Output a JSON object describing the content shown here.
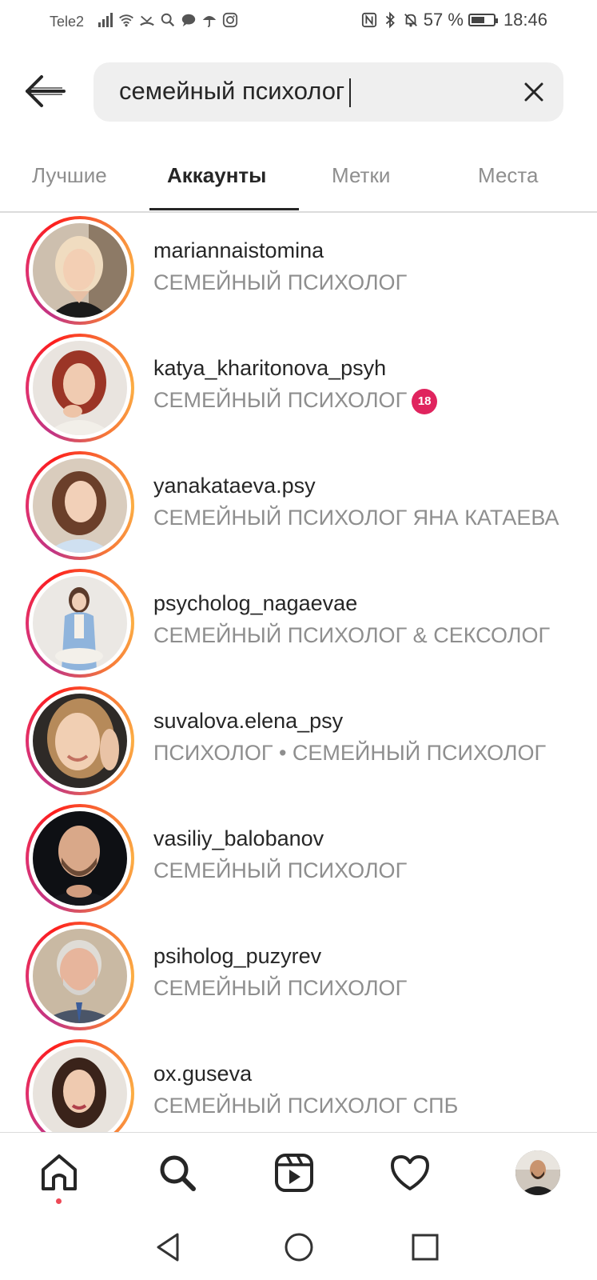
{
  "status_bar": {
    "carrier": "Tele2",
    "battery": "57 %",
    "battery_level": 0.57,
    "time": "18:46"
  },
  "search": {
    "query": "семейный психолог"
  },
  "tabs": [
    {
      "label": "Лучшие",
      "active": false
    },
    {
      "label": "Аккаунты",
      "active": true
    },
    {
      "label": "Метки",
      "active": false
    },
    {
      "label": "Места",
      "active": false
    }
  ],
  "accounts": [
    {
      "username": "mariannaistomina",
      "subtitle": "СЕМЕЙНЫЙ ПСИХОЛОГ"
    },
    {
      "username": "katya_kharitonova_psyh",
      "subtitle": "СЕМЕЙНЫЙ ПСИХОЛОГ",
      "badge": "18"
    },
    {
      "username": "yanakataeva.psy",
      "subtitle": "СЕМЕЙНЫЙ ПСИХОЛОГ ЯНА КАТАЕВА"
    },
    {
      "username": "psycholog_nagaevae",
      "subtitle": "СЕМЕЙНЫЙ ПСИХОЛОГ & СЕКСОЛОГ"
    },
    {
      "username": "suvalova.elena_psy",
      "subtitle": "ПСИХОЛОГ • СЕМЕЙНЫЙ ПСИХОЛОГ"
    },
    {
      "username": "vasiliy_balobanov",
      "subtitle": "СЕМЕЙНЫЙ ПСИХОЛОГ"
    },
    {
      "username": "psiholog_puzyrev",
      "subtitle": "СЕМЕЙНЫЙ ПСИХОЛОГ"
    },
    {
      "username": "ox.guseva",
      "subtitle": "СЕМЕЙНЫЙ ПСИХОЛОГ СПБ"
    }
  ],
  "colors": {
    "text_primary": "#262626",
    "text_secondary": "#8e8e8e",
    "search_bg": "#efefef",
    "story_ring": [
      "#c13584",
      "#e1306c",
      "#f77737",
      "#fcaf45"
    ],
    "notification_dot": "#ed4956"
  },
  "icons": {
    "back": "back-arrow-icon",
    "clear": "close-icon",
    "nav": [
      "home-icon",
      "search-icon",
      "reels-icon",
      "heart-icon",
      "profile-avatar"
    ],
    "system": [
      "back-triangle-icon",
      "home-circle-icon",
      "recents-square-icon"
    ]
  }
}
